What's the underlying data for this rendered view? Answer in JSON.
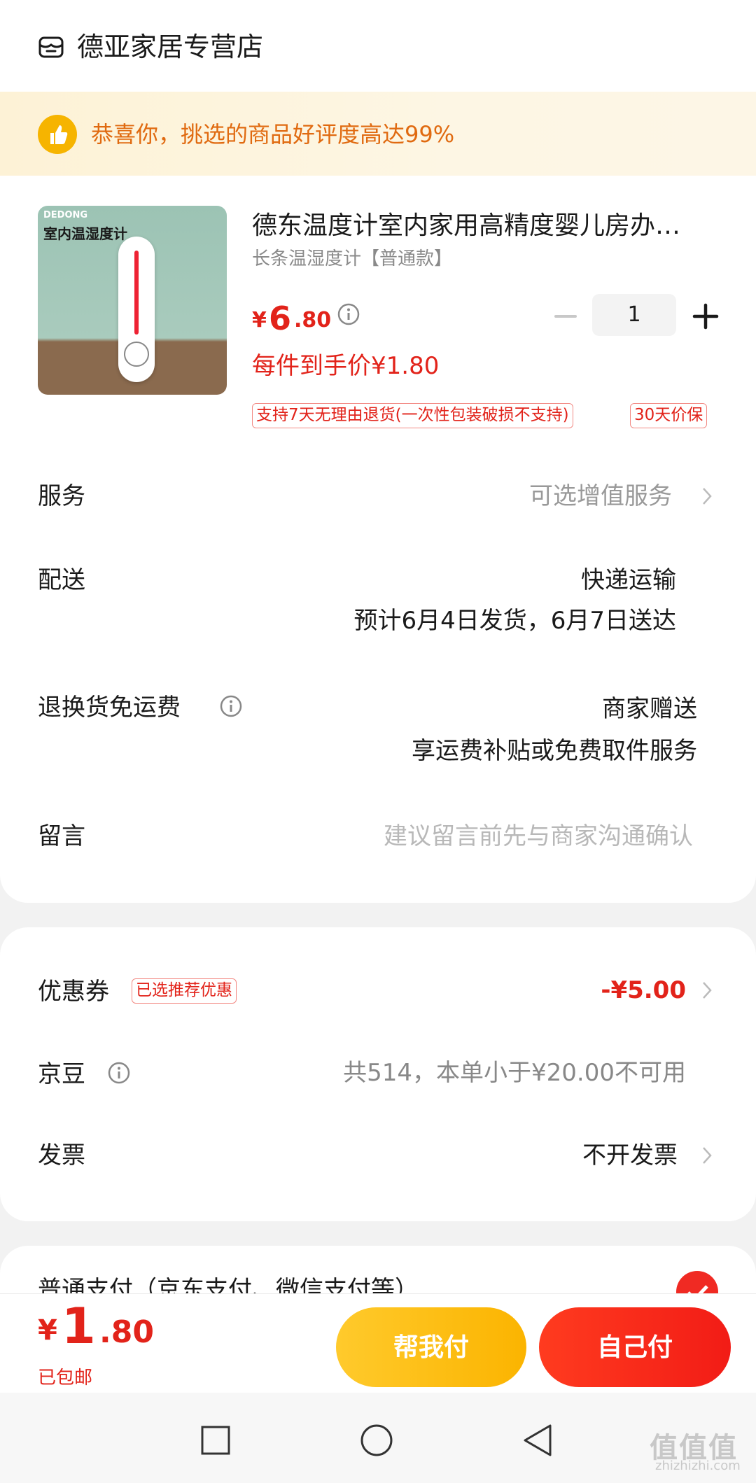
{
  "store": {
    "name": "德亚家居专营店",
    "icon": "store-icon"
  },
  "banner": {
    "text": "恭喜你，挑选的商品好评度高达99%",
    "icon": "thumbs-up-icon"
  },
  "product": {
    "image_text": "室内温湿度计",
    "image_brand": "DEDONG",
    "title": "德东温度计室内家用高精度婴儿房办…",
    "spec": "长条温湿度计【普通款】",
    "price_symbol": "¥",
    "price_int": "6",
    "price_dec": ".80",
    "quantity": "1",
    "unit_price": "每件到手价¥1.80",
    "tags": [
      "支持7天无理由退货(一次性包装破损不支持)",
      "30天价保"
    ]
  },
  "rows": {
    "service": {
      "label": "服务",
      "value": "可选增值服务"
    },
    "delivery": {
      "label": "配送",
      "value_line1": "快递运输",
      "value_line2": "预计6月4日发货，6月7日送达"
    },
    "return": {
      "label": "退换货免运费",
      "value_line1": "商家赠送",
      "value_line2": "享运费补贴或免费取件服务"
    },
    "message": {
      "label": "留言",
      "placeholder": "建议留言前先与商家沟通确认"
    }
  },
  "discounts": {
    "coupon": {
      "label": "优惠券",
      "badge": "已选推荐优惠",
      "value": "-¥5.00"
    },
    "jingdou": {
      "label": "京豆",
      "value": "共514，本单小于¥20.00不可用"
    },
    "invoice": {
      "label": "发票",
      "value": "不开发票"
    }
  },
  "payment": {
    "label": "普通支付（京东支付、微信支付等）"
  },
  "footer": {
    "total_symbol": "¥",
    "total_int": "1",
    "total_dec": ".80",
    "shipping": "已包邮",
    "btn_help": "帮我付",
    "btn_self": "自己付"
  },
  "watermark": {
    "text": "值值值",
    "sub": "zhizhizhi.com"
  },
  "colors": {
    "accent_red": "#e2231a",
    "banner_orange": "#e06a10",
    "help_yellow": "#fbb400"
  }
}
